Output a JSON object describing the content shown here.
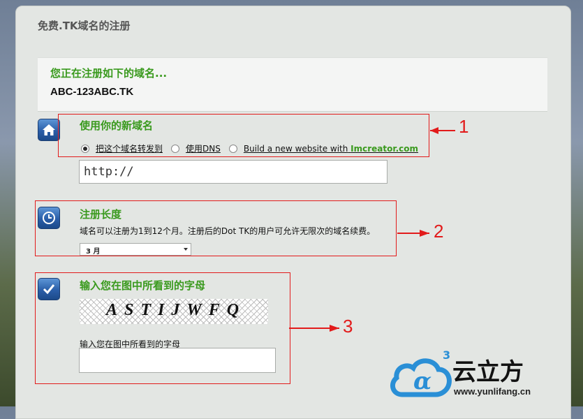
{
  "page": {
    "title": "免费.TK域名的注册"
  },
  "domain": {
    "heading": "您正在注册如下的域名...",
    "name": "ABC-123ABC.TK"
  },
  "section1": {
    "title": "使用你的新域名",
    "options": [
      {
        "label": "把这个域名转发到",
        "checked": true
      },
      {
        "label": "使用DNS",
        "checked": false
      },
      {
        "label": "Build a new website with",
        "brand": "Imcreator.com",
        "checked": false
      }
    ],
    "url_value": "http://",
    "icon": "home-icon"
  },
  "section2": {
    "title": "注册长度",
    "description": "域名可以注册为1到12个月。注册后的Dot TK的用户可允许无限次的域名续费。",
    "select_value": "3 月",
    "icon": "clock-icon"
  },
  "section3": {
    "title": "输入您在图中所看到的字母",
    "captcha_text": "ASTIJWFQ",
    "input_label": "输入您在图中所看到的字母",
    "icon": "checkmark-icon"
  },
  "annotations": {
    "num1": "1",
    "num2": "2",
    "num3": "3"
  },
  "watermark": {
    "brand": "云立方",
    "url": "www.yunlifang.cn",
    "superscript": "3"
  },
  "colors": {
    "accent_green": "#3a9a1e",
    "annotation_red": "#e21b1b",
    "icon_blue": "#2a5ea8"
  }
}
